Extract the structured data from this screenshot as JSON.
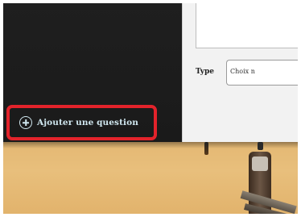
{
  "question_form": {
    "type_label": "Type",
    "type_select_value": "Choix n"
  },
  "add_question": {
    "label": "Ajouter une question",
    "icon": "plus-circle-icon",
    "highlight_color": "#e3232b"
  },
  "colors": {
    "background_dark": "#1c1c1c",
    "button_text": "#cfe6ee"
  }
}
